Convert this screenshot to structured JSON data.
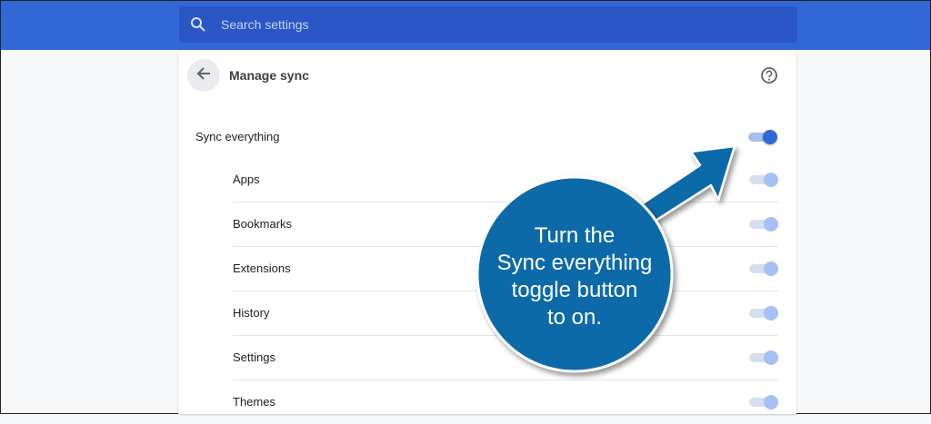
{
  "search": {
    "placeholder": "Search settings"
  },
  "header": {
    "title": "Manage sync"
  },
  "sync_everything": {
    "label": "Sync everything",
    "state": "on"
  },
  "items": [
    {
      "label": "Apps",
      "state": "on"
    },
    {
      "label": "Bookmarks",
      "state": "on"
    },
    {
      "label": "Extensions",
      "state": "on"
    },
    {
      "label": "History",
      "state": "on"
    },
    {
      "label": "Settings",
      "state": "on"
    },
    {
      "label": "Themes",
      "state": "on"
    }
  ],
  "annotation": {
    "text_lines": [
      "Turn the",
      "Sync everything",
      "toggle button",
      "to on."
    ]
  },
  "colors": {
    "topbar": "#3367d6",
    "accent": "#3367d6",
    "callout": "#0d6aa8"
  },
  "icons": {
    "search": "search-icon",
    "back": "back-arrow-icon",
    "help": "help-icon"
  }
}
